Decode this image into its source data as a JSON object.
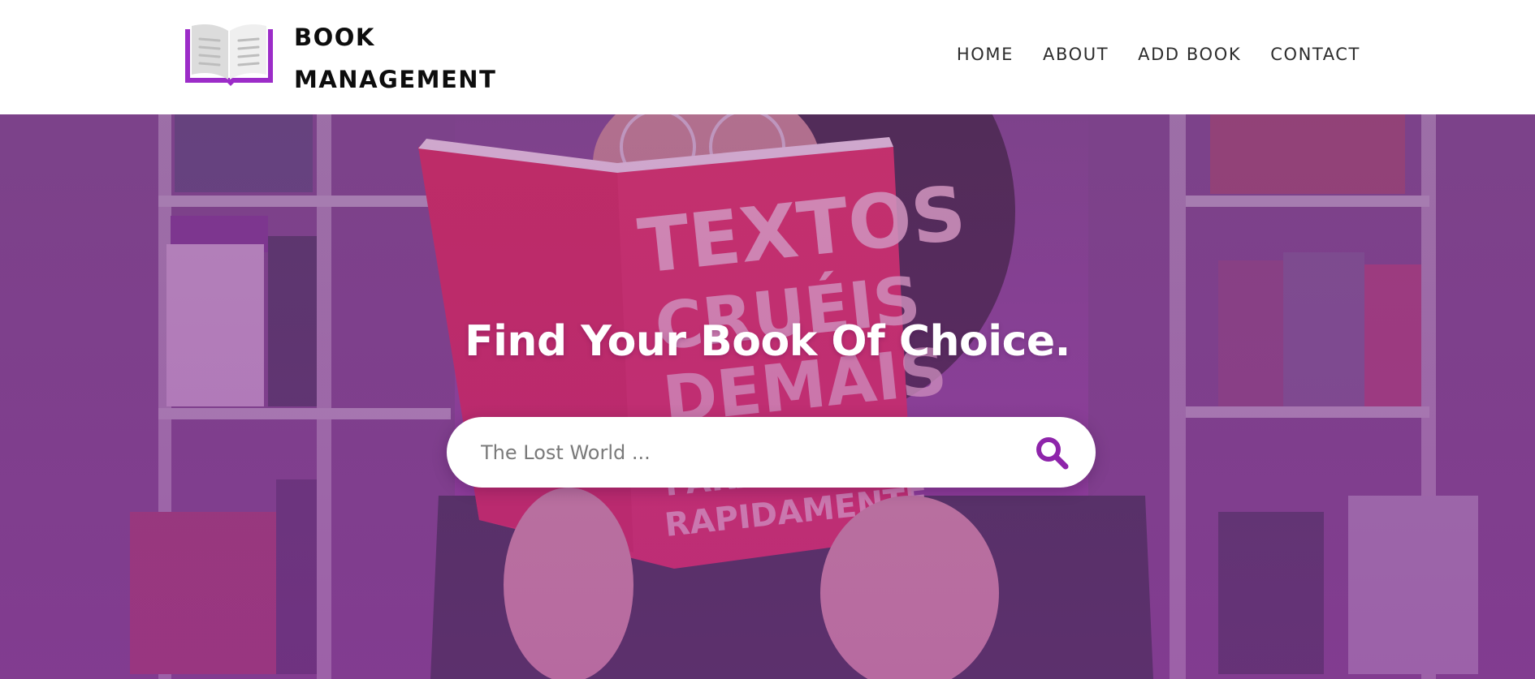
{
  "header": {
    "brand_line1": "BOOK",
    "brand_line2": "MANAGEMENT",
    "logo_icon": "open-book-icon",
    "nav": [
      {
        "label": "HOME"
      },
      {
        "label": "ABOUT"
      },
      {
        "label": "ADD BOOK"
      },
      {
        "label": "CONTACT"
      }
    ]
  },
  "hero": {
    "title": "Find Your Book Of Choice.",
    "background_image": "woman-reading-book-in-library",
    "book_cover_text": "TEXTOS CRUÉIS DEMAIS PARA SEREM LIDOS RAPIDAMENTE",
    "search": {
      "placeholder": "The Lost World ...",
      "value": "",
      "icon": "search-icon"
    }
  },
  "colors": {
    "accent": "#8e24aa",
    "logo_purple": "#9c2cc8",
    "hero_overlay": "#8a3a9a",
    "header_bg": "#ffffff",
    "text_dark": "#0d0d0d"
  }
}
